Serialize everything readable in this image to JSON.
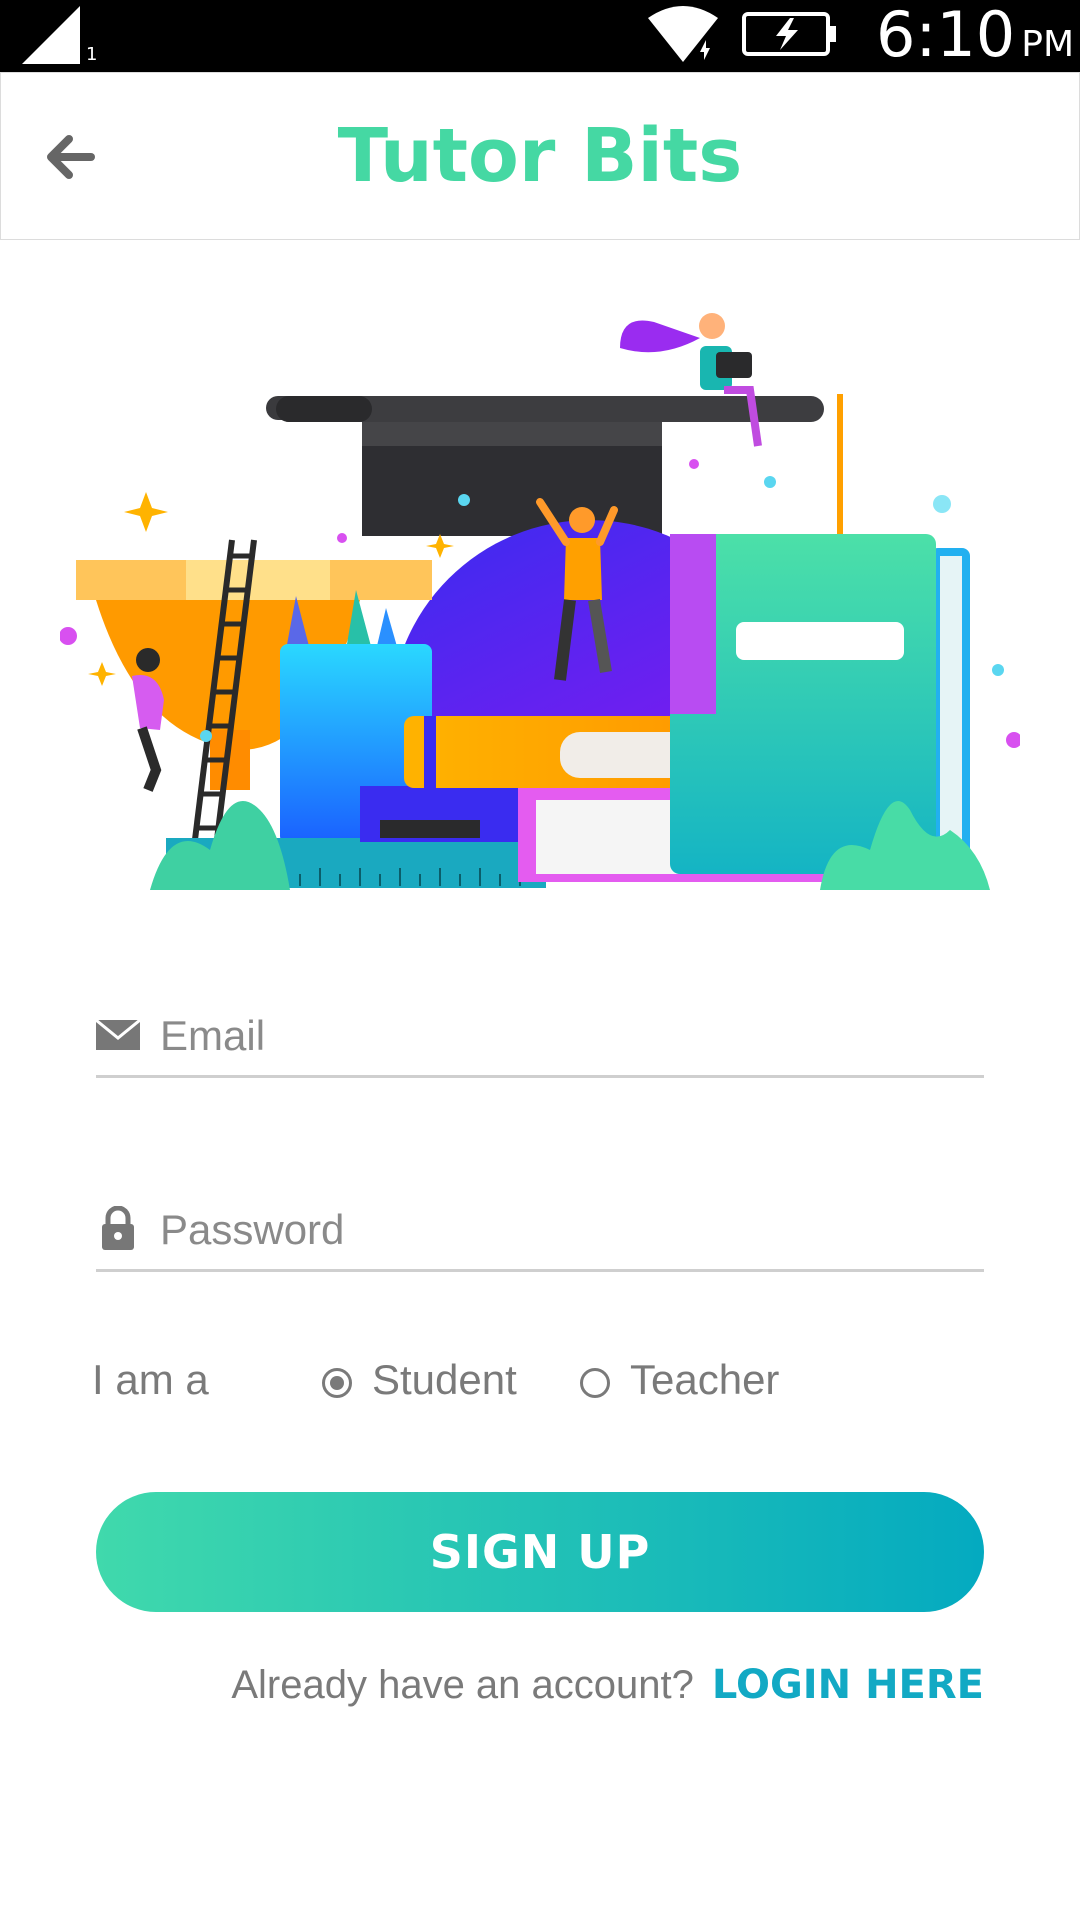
{
  "status_bar": {
    "sim_number": "1",
    "time": "6:10",
    "ampm": "PM",
    "icons": [
      "signal-icon",
      "wifi-icon",
      "battery-charging-icon"
    ]
  },
  "app_bar": {
    "title": "Tutor Bits",
    "back_icon": "arrow-left-icon"
  },
  "form": {
    "email": {
      "placeholder": "Email",
      "value": "",
      "icon": "mail-icon"
    },
    "password": {
      "placeholder": "Password",
      "value": "",
      "icon": "lock-icon"
    },
    "role": {
      "label": "I am a",
      "options": [
        {
          "label": "Student",
          "selected": true
        },
        {
          "label": "Teacher",
          "selected": false
        }
      ]
    },
    "signup_label": "SIGN UP",
    "login_prompt": "Already have an account?",
    "login_link": "LOGIN HERE"
  },
  "colors": {
    "brand": "#45d8a3",
    "button_start": "#40d9ac",
    "button_end": "#04aac0",
    "link": "#12a9c4"
  }
}
